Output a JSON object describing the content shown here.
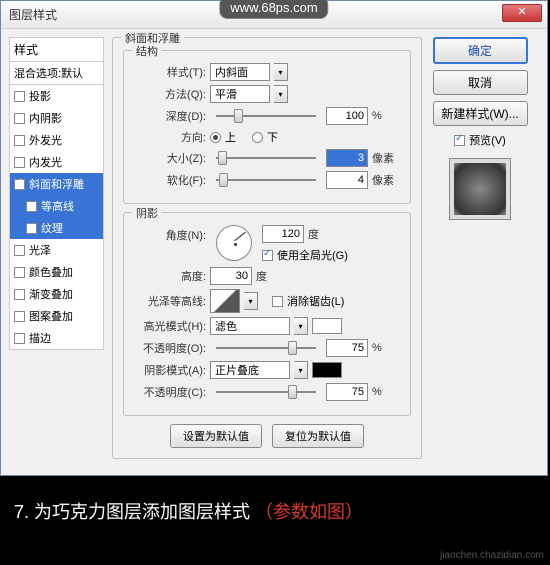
{
  "window": {
    "title": "图层样式",
    "watermark": "www.68ps.com",
    "close": "✕"
  },
  "left": {
    "styles_header": "样式",
    "blend_default": "混合选项:默认",
    "items": [
      {
        "label": "投影",
        "checked": false
      },
      {
        "label": "内阴影",
        "checked": false
      },
      {
        "label": "外发光",
        "checked": false
      },
      {
        "label": "内发光",
        "checked": false
      },
      {
        "label": "斜面和浮雕",
        "checked": true,
        "selected": true
      },
      {
        "label": "等高线",
        "checked": false,
        "sub": true,
        "selected": true
      },
      {
        "label": "纹理",
        "checked": false,
        "sub": true,
        "selected": true
      },
      {
        "label": "光泽",
        "checked": false
      },
      {
        "label": "颜色叠加",
        "checked": false
      },
      {
        "label": "渐变叠加",
        "checked": false
      },
      {
        "label": "图案叠加",
        "checked": false
      },
      {
        "label": "描边",
        "checked": false
      }
    ]
  },
  "bevel": {
    "group_title": "斜面和浮雕",
    "structure_title": "结构",
    "style_label": "样式(T):",
    "style_value": "内斜面",
    "technique_label": "方法(Q):",
    "technique_value": "平滑",
    "depth_label": "深度(D):",
    "depth_value": "100",
    "depth_unit": "%",
    "direction_label": "方向:",
    "dir_up": "上",
    "dir_down": "下",
    "size_label": "大小(Z):",
    "size_value": "3",
    "size_unit": "像素",
    "soften_label": "软化(F):",
    "soften_value": "4",
    "soften_unit": "像素",
    "shading_title": "阴影",
    "angle_label": "角度(N):",
    "angle_value": "120",
    "angle_unit": "度",
    "global_light": "使用全局光(G)",
    "altitude_label": "高度:",
    "altitude_value": "30",
    "altitude_unit": "度",
    "gloss_contour_label": "光泽等高线:",
    "antialias": "消除锯齿(L)",
    "highlight_mode_label": "高光模式(H):",
    "highlight_mode_value": "滤色",
    "highlight_color": "#ffffff",
    "highlight_opacity_label": "不透明度(O):",
    "highlight_opacity_value": "75",
    "opacity_unit": "%",
    "shadow_mode_label": "阴影模式(A):",
    "shadow_mode_value": "正片叠底",
    "shadow_color": "#000000",
    "shadow_opacity_label": "不透明度(C):",
    "shadow_opacity_value": "75",
    "set_default": "设置为默认值",
    "reset_default": "复位为默认值"
  },
  "right": {
    "ok": "确定",
    "cancel": "取消",
    "new_style": "新建样式(W)...",
    "preview": "预览(V)"
  },
  "caption": {
    "num": "7.",
    "text": "为巧克力图层添加图层样式",
    "note": "（参数如图）"
  },
  "footer_wm": "jiaochen.chazidian.com"
}
